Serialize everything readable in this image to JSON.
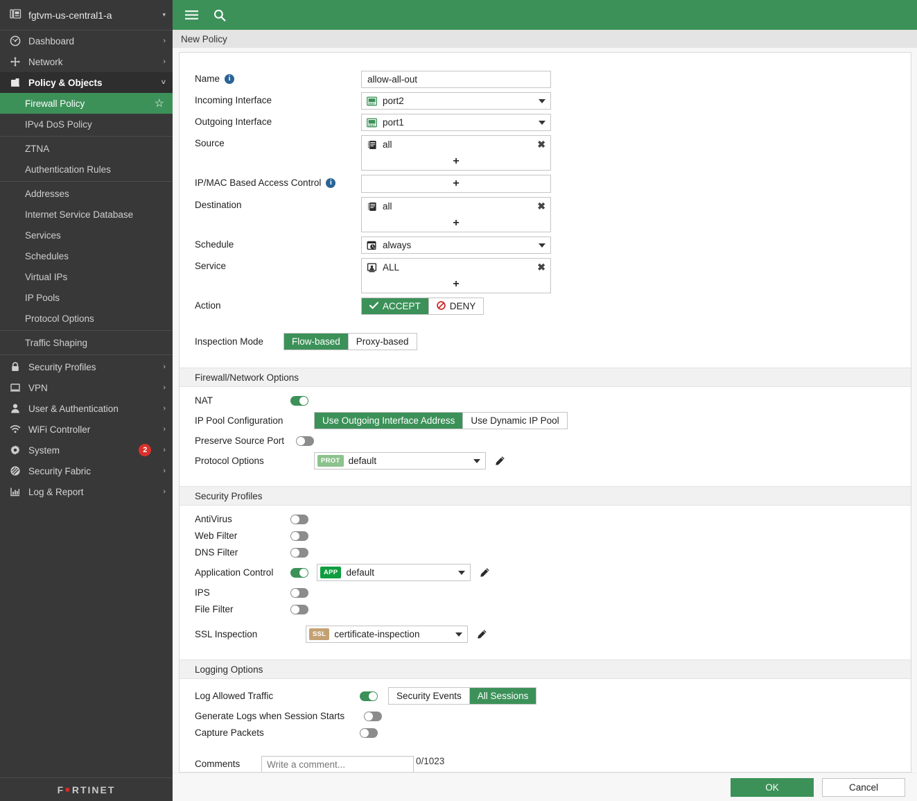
{
  "sidebar": {
    "device": {
      "name": "fgtvm-us-central1-a",
      "icon": "device-icon",
      "caret": "▾"
    },
    "nav": [
      {
        "label": "Dashboard",
        "icon": "dashboard-icon",
        "chevron": "›",
        "type": "group"
      },
      {
        "label": "Network",
        "icon": "network-icon",
        "chevron": "›",
        "type": "group"
      },
      {
        "label": "Policy & Objects",
        "icon": "policy-icon",
        "chevron": "˅",
        "type": "group",
        "expanded": true
      }
    ],
    "policy_children": [
      {
        "label": "Firewall Policy",
        "active": true,
        "star": "☆"
      },
      {
        "label": "IPv4 DoS Policy"
      },
      {
        "separator_after": false,
        "label": "ZTNA"
      },
      {
        "label": "Authentication Rules"
      },
      {
        "label": "Addresses"
      },
      {
        "label": "Internet Service Database"
      },
      {
        "label": "Services"
      },
      {
        "label": "Schedules"
      },
      {
        "label": "Virtual IPs"
      },
      {
        "label": "IP Pools"
      },
      {
        "label": "Protocol Options"
      },
      {
        "label": "Traffic Shaping"
      }
    ],
    "nav_bottom": [
      {
        "label": "Security Profiles",
        "icon": "lock-icon",
        "chevron": "›"
      },
      {
        "label": "VPN",
        "icon": "monitor-icon",
        "chevron": "›"
      },
      {
        "label": "User & Authentication",
        "icon": "user-icon",
        "chevron": "›"
      },
      {
        "label": "WiFi Controller",
        "icon": "wifi-icon",
        "chevron": "›"
      },
      {
        "label": "System",
        "icon": "gear-icon",
        "chevron": "›",
        "badge": "2"
      },
      {
        "label": "Security Fabric",
        "icon": "fabric-icon",
        "chevron": "›"
      },
      {
        "label": "Log & Report",
        "icon": "chart-icon",
        "chevron": "›"
      }
    ],
    "brand": {
      "part1": "F",
      "dot": "■",
      "part2": "RTINET"
    }
  },
  "topbar": {
    "menu_icon": "hamburger-icon",
    "search_icon": "search-icon"
  },
  "breadcrumb": {
    "title": "New Policy"
  },
  "form": {
    "name": {
      "label": "Name",
      "value": "allow-all-out",
      "has_info": true
    },
    "incoming_interface": {
      "label": "Incoming Interface",
      "value": "port2",
      "icon": "interface-icon"
    },
    "outgoing_interface": {
      "label": "Outgoing Interface",
      "value": "port1",
      "icon": "interface-icon"
    },
    "source": {
      "label": "Source",
      "items": [
        "all"
      ],
      "item_icon": "address-icon",
      "remove": "✖",
      "add": "+"
    },
    "ipmac": {
      "label": "IP/MAC Based Access Control",
      "has_info": true,
      "add": "+"
    },
    "destination": {
      "label": "Destination",
      "items": [
        "all"
      ],
      "item_icon": "address-icon",
      "remove": "✖",
      "add": "+"
    },
    "schedule": {
      "label": "Schedule",
      "value": "always",
      "icon": "schedule-icon"
    },
    "service": {
      "label": "Service",
      "items": [
        "ALL"
      ],
      "item_icon": "service-icon",
      "remove": "✖",
      "add": "+"
    },
    "action": {
      "label": "Action",
      "options": [
        "ACCEPT",
        "DENY"
      ],
      "selected": "ACCEPT",
      "accept_icon": "check-icon",
      "deny_icon": "deny-icon"
    },
    "inspection_mode": {
      "label": "Inspection Mode",
      "options": [
        "Flow-based",
        "Proxy-based"
      ],
      "selected": "Flow-based"
    }
  },
  "firewall_network_options": {
    "title": "Firewall/Network Options",
    "nat": {
      "label": "NAT",
      "on": true
    },
    "ip_pool_configuration": {
      "label": "IP Pool Configuration",
      "options": [
        "Use Outgoing Interface Address",
        "Use Dynamic IP Pool"
      ],
      "selected": "Use Outgoing Interface Address"
    },
    "preserve_source_port": {
      "label": "Preserve Source Port",
      "on": false
    },
    "protocol_options": {
      "label": "Protocol Options",
      "badge": "PROT",
      "value": "default",
      "badge_color": "#8cc28c",
      "edit_icon": "pencil-icon"
    }
  },
  "security_profiles": {
    "title": "Security Profiles",
    "rows": [
      {
        "label": "AntiVirus",
        "on": false
      },
      {
        "label": "Web Filter",
        "on": false
      },
      {
        "label": "DNS Filter",
        "on": false
      },
      {
        "label": "Application Control",
        "on": true,
        "badge": "APP",
        "badge_color": "#0f9d3f",
        "value": "default",
        "edit_icon": "pencil-icon"
      },
      {
        "label": "IPS",
        "on": false
      },
      {
        "label": "File Filter",
        "on": false
      }
    ],
    "ssl_inspection": {
      "label": "SSL Inspection",
      "badge": "SSL",
      "badge_color": "#c4a173",
      "value": "certificate-inspection",
      "edit_icon": "pencil-icon"
    }
  },
  "logging_options": {
    "title": "Logging Options",
    "log_allowed_traffic": {
      "label": "Log Allowed Traffic",
      "on": true,
      "options": [
        "Security Events",
        "All Sessions"
      ],
      "selected": "All Sessions"
    },
    "generate_logs": {
      "label": "Generate Logs when Session Starts",
      "on": false
    },
    "capture_packets": {
      "label": "Capture Packets",
      "on": false
    }
  },
  "comments": {
    "label": "Comments",
    "placeholder": "Write a comment...",
    "value": "",
    "counter": "0/1023"
  },
  "footer": {
    "ok": "OK",
    "cancel": "Cancel"
  },
  "colors": {
    "accent_green": "#3c9159",
    "sidebar_bg": "#383838",
    "badge_red": "#d9302c",
    "info_blue": "#2a6496"
  }
}
